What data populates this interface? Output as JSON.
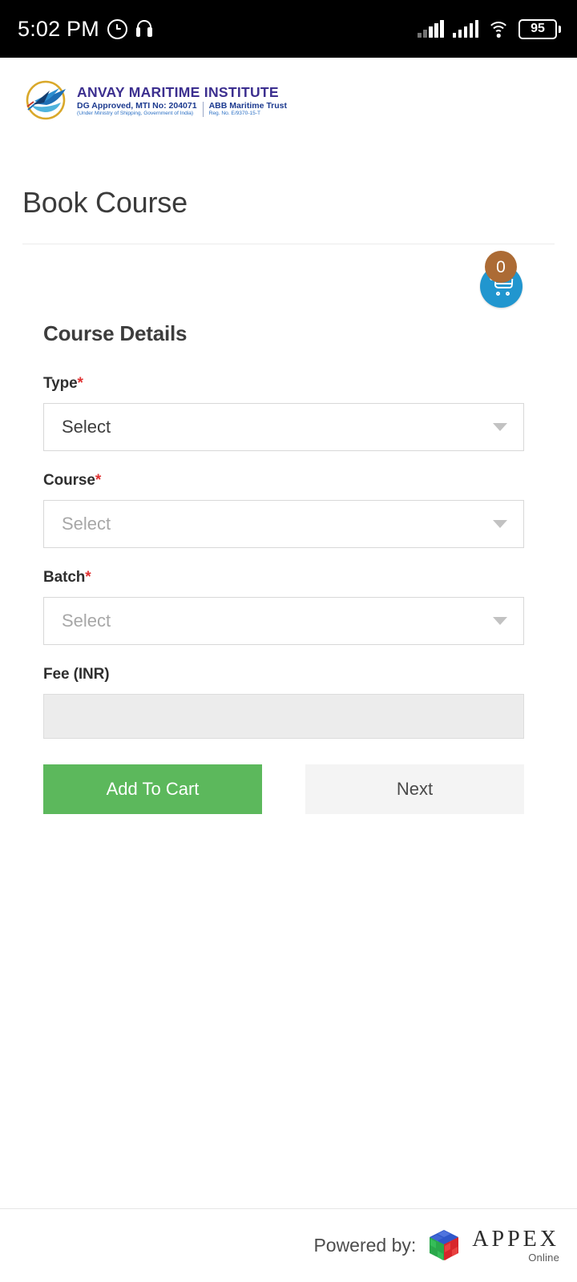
{
  "statusbar": {
    "time": "5:02 PM",
    "alarm_icon": "alarm-clock-icon",
    "headphone_icon": "headphone-icon",
    "signal_icon_1": "cellular-signal-icon",
    "signal_icon_2": "cellular-signal-icon",
    "wifi_icon": "wifi-icon",
    "battery_level": "95"
  },
  "brand": {
    "title": "ANVAY MARITIME INSTITUTE",
    "left_line1": "DG Approved, MTI No: 204071",
    "left_line2": "(Under Ministry of Shipping, Government of India)",
    "right_line1": "ABB Maritime Trust",
    "right_line2": "Reg. No. E/9370-15-T",
    "logo_icon": "anvay-ship-logo-icon"
  },
  "page": {
    "title": "Book Course"
  },
  "cart": {
    "count": "0",
    "icon": "shopping-cart-icon"
  },
  "form": {
    "section_title": "Course Details",
    "fields": [
      {
        "label": "Type",
        "required": "*",
        "value": "Select",
        "placeholder_style": false
      },
      {
        "label": "Course",
        "required": "*",
        "value": "Select",
        "placeholder_style": true
      },
      {
        "label": "Batch",
        "required": "*",
        "value": "Select",
        "placeholder_style": true
      }
    ],
    "fee": {
      "label": "Fee (INR)",
      "value": ""
    },
    "buttons": {
      "add_to_cart": "Add To Cart",
      "next": "Next"
    }
  },
  "footer": {
    "powered_by": "Powered by:",
    "logo_icon": "appex-cube-icon",
    "brand": "APPEX",
    "brand_sub": "Online"
  },
  "colors": {
    "accent_green": "#5cb85c",
    "cart_blue": "#2196cf",
    "badge_brown": "#ac6b35",
    "required_red": "#e03131",
    "brand_purple": "#3c2f8f"
  }
}
